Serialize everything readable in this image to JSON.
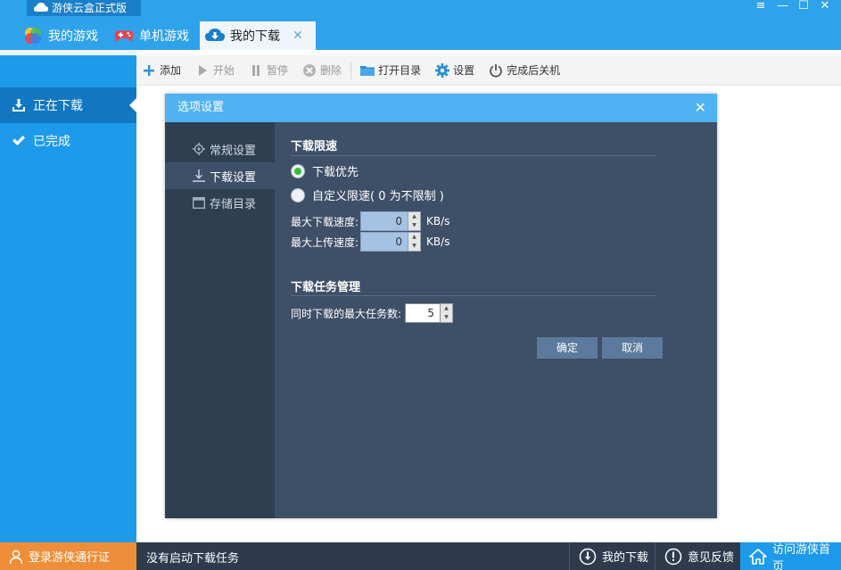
{
  "window": {
    "app_title": "游侠云盒正式版",
    "controls": {
      "menu": "≡",
      "minimize": "—",
      "maximize": "☐",
      "close": "✕"
    }
  },
  "tabs": [
    {
      "label": "我的游戏",
      "icon": "multicolor-circles-icon"
    },
    {
      "label": "单机游戏",
      "icon": "gamepad-icon"
    },
    {
      "label": "我的下载",
      "icon": "cloud-download-icon",
      "close": "✕"
    }
  ],
  "sidebar": {
    "items": [
      {
        "label": "正在下载",
        "icon": "download-icon"
      },
      {
        "label": "已完成",
        "icon": "checkmark-icon"
      }
    ]
  },
  "toolbar": {
    "add": "添加",
    "start": "开始",
    "pause": "暂停",
    "delete": "删除",
    "open_dir": "打开目录",
    "settings": "设置",
    "shutdown_after": "完成后关机"
  },
  "dialog": {
    "title": "选项设置",
    "close": "✕",
    "nav": [
      {
        "label": "常规设置",
        "icon": "gear-icon"
      },
      {
        "label": "下载设置",
        "icon": "download-icon"
      },
      {
        "label": "存储目录",
        "icon": "folder-window-icon"
      }
    ],
    "speed_section": {
      "title": "下载限速",
      "option_priority": "下载优先",
      "option_custom": "自定义限速( 0 为不限制 )",
      "max_download_label": "最大下载速度:",
      "max_download_value": "0",
      "max_upload_label": "最大上传速度:",
      "max_upload_value": "0",
      "unit": "KB/s"
    },
    "task_section": {
      "title": "下载任务管理",
      "max_tasks_label": "同时下载的最大任务数:",
      "max_tasks_value": "5"
    },
    "ok": "确定",
    "cancel": "取消"
  },
  "statusbar": {
    "login": "登录游侠通行证",
    "status": "没有启动下载任务",
    "my_downloads": "我的下载",
    "feedback": "意见反馈",
    "home": "访问游侠首页"
  },
  "colors": {
    "title_blue": "#2fa2ec",
    "sidebar_blue": "#1e9aeb",
    "sidebar_active": "#1177c2",
    "dialog_bg": "#3e5067",
    "dialog_nav": "#2f3f52",
    "dialog_header": "#4fb2f2",
    "status_bg": "#2e3b4c",
    "login_orange": "#ef8e3a"
  }
}
